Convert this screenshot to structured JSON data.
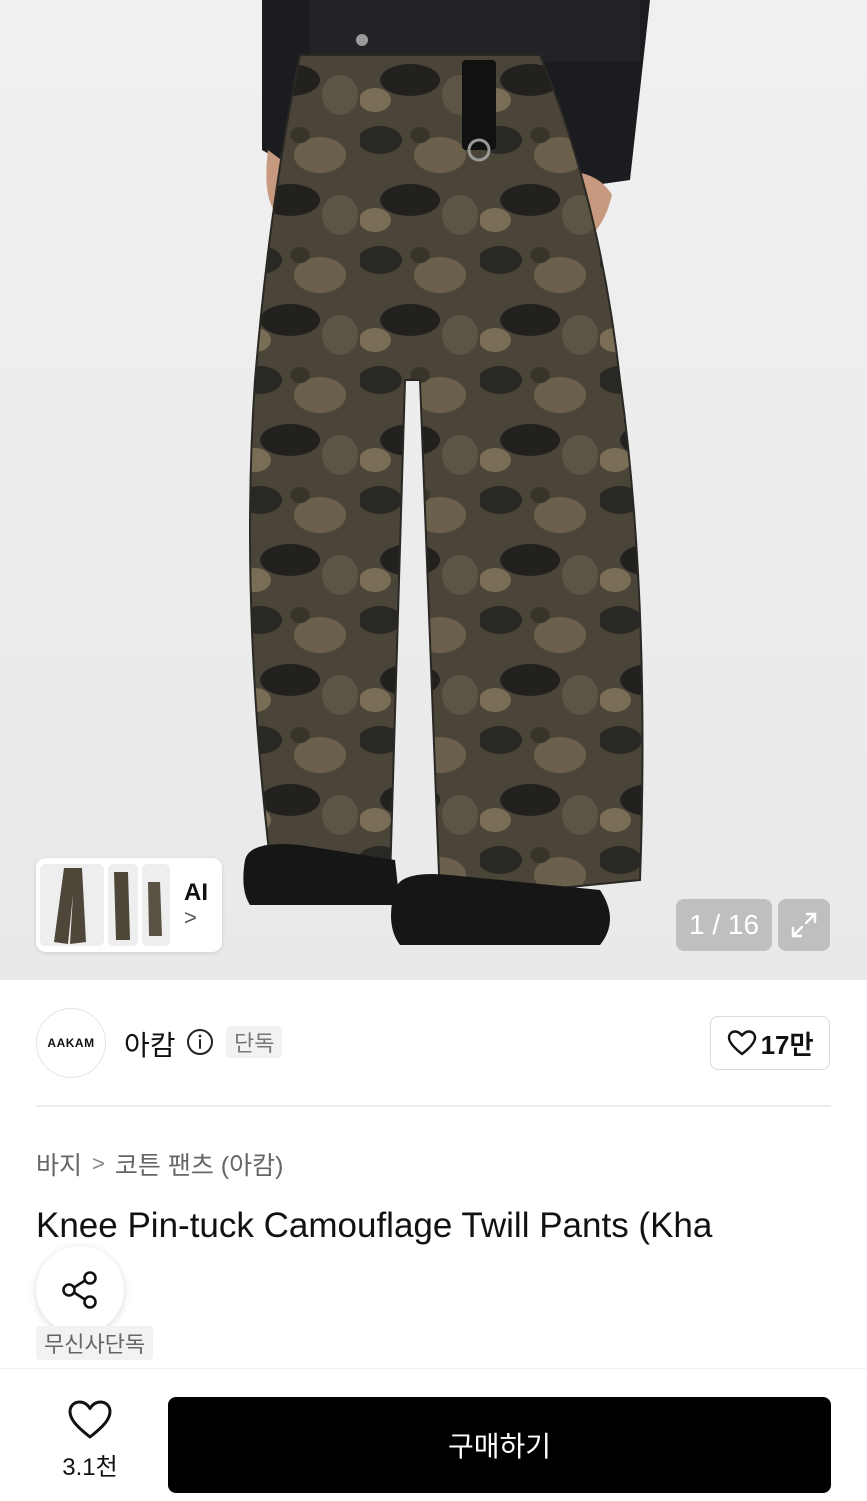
{
  "gallery": {
    "counter": "1 / 16",
    "ai_label": "AI",
    "ai_chevron": ">",
    "thumbnail_count": 3
  },
  "brand": {
    "logo_text": "AAKAM",
    "name": "아캄",
    "exclusive_badge": "단독",
    "like_count": "17만"
  },
  "breadcrumb": {
    "category": "바지",
    "separator": ">",
    "subcategory": "코튼 팬츠 (아캄)"
  },
  "product": {
    "title": "Knee Pin-tuck Camouflage Twill Pants (Kha",
    "tag": "무신사단독"
  },
  "bottom_bar": {
    "wish_count": "3.1천",
    "buy_label": "구매하기"
  },
  "icons": [
    "info-icon",
    "heart-icon",
    "share-icon",
    "expand-icon",
    "chevron-right-icon"
  ],
  "colors": {
    "accent": "#000000",
    "badge_bg": "#f2f2f2"
  }
}
